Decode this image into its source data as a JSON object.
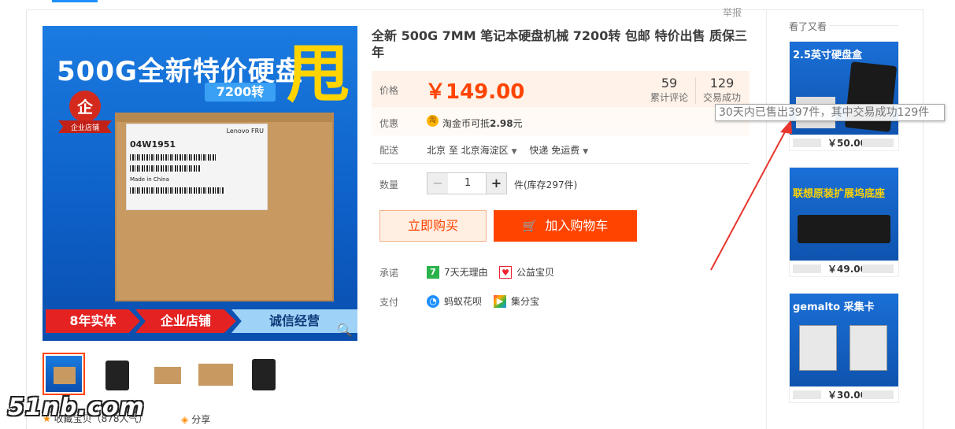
{
  "header": {
    "report_label": "举报"
  },
  "gallery": {
    "headline": "500G全新特价硬盘",
    "speed_tag": "7200转",
    "big_char": "甩",
    "badge_text": "企业店铺",
    "box_label": {
      "brand": "Lenovo   FRU",
      "part_no": "04W1951",
      "origin": "Made in China"
    },
    "strip": [
      "8年实体",
      "企业店铺",
      "诚信经营"
    ],
    "zoom_icon": "magnifier-icon",
    "thumb_count": 5
  },
  "bottom": {
    "favorite_text": "收藏宝贝（878人气）",
    "share_label": "分享"
  },
  "watermark": "51nb.com",
  "product": {
    "title": "全新 500G 7MM 笔记本硬盘机械 7200转 包邮 特价出售 质保三年",
    "price_label": "价格",
    "price": "￥149.00",
    "reviews_count": "59",
    "reviews_label": "累计评论",
    "deals_count": "129",
    "deals_label": "交易成功",
    "promo_label": "优惠",
    "promo_text_a": "淘金币可抵",
    "promo_amount": "2.98",
    "promo_unit": "元",
    "shipping_label": "配送",
    "ship_from": "北京 至",
    "ship_to": "北京海淀区",
    "ship_method": "快递 免运费",
    "quantity_label": "数量",
    "quantity": "1",
    "stock": "件(库存297件)",
    "buy_now": "立即购买",
    "add_to_cart": "加入购物车",
    "promise_label": "承诺",
    "promise_items": [
      "7天无理由",
      "公益宝贝"
    ],
    "pay_label": "支付",
    "pay_items": [
      "蚂蚁花呗",
      "集分宝"
    ]
  },
  "tooltip": "30天内已售出397件，其中交易成功129件",
  "sidebar": {
    "title": "看了又看",
    "items": [
      {
        "caption": "2.5英寸硬盘盒",
        "price": "￥50.00"
      },
      {
        "caption": "联想原装扩展坞底座",
        "price": "￥49.00"
      },
      {
        "caption": "gemalto 采集卡",
        "price": "￥30.00"
      }
    ]
  },
  "colors": {
    "accent": "#ff4400",
    "price_bg": "#fff2e8",
    "banner_blue": "#1a7be0",
    "arrow_red": "#e8352e"
  }
}
